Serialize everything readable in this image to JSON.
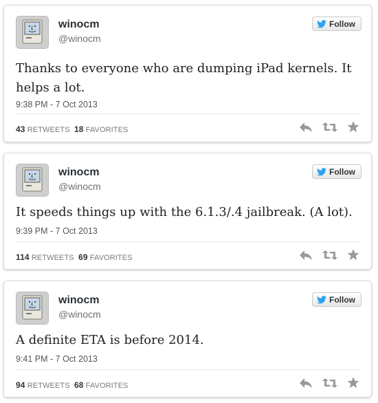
{
  "tweets": [
    {
      "name": "winocm",
      "handle": "@winocm",
      "follow_label": "Follow",
      "text_line1": "Thanks to everyone who are dumping iPad kernels. It",
      "text_line2": "helps a lot.",
      "time": "9:38 PM - 7 Oct 2013",
      "retweets": "43",
      "retweets_label": "RETWEETS",
      "favorites": "18",
      "favorites_label": "FAVORITES"
    },
    {
      "name": "winocm",
      "handle": "@winocm",
      "follow_label": "Follow",
      "text_line1": "It speeds things up with the 6.1.3/.4 jailbreak. (A lot).",
      "time": "9:39 PM - 7 Oct 2013",
      "retweets": "114",
      "retweets_label": "RETWEETS",
      "favorites": "69",
      "favorites_label": "FAVORITES"
    },
    {
      "name": "winocm",
      "handle": "@winocm",
      "follow_label": "Follow",
      "text_line1": "A definite ETA is before 2014.",
      "time": "9:41 PM - 7 Oct 2013",
      "retweets": "94",
      "retweets_label": "RETWEETS",
      "favorites": "68",
      "favorites_label": "FAVORITES"
    }
  ],
  "icons": {
    "avatar": "classic-mac-icon",
    "follow": "twitter-bird-icon",
    "reply": "reply-icon",
    "retweet": "retweet-icon",
    "favorite": "star-icon"
  },
  "colors": {
    "twitter_blue": "#2ea3f2",
    "action_gray": "#999999"
  }
}
